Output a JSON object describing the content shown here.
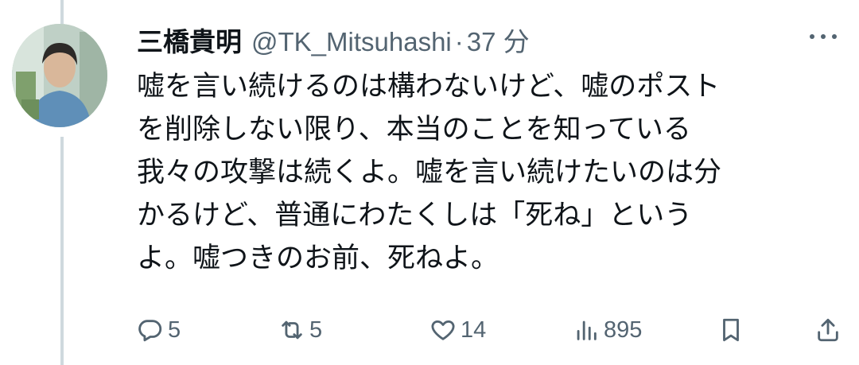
{
  "post": {
    "display_name": "三橋貴明",
    "handle": "@TK_Mitsuhashi",
    "separator": "·",
    "time": "37 分",
    "lines": [
      "嘘を言い続けるのは構わないけど、嘘のポスト",
      "を削除しない限り、本当のことを知っている",
      "我々の攻撃は続くよ。嘘を言い続けたいのは分",
      "かるけど、普通にわたくしは「死ね」という",
      "よ。嘘つきのお前、死ねよ。"
    ]
  },
  "actions": {
    "reply": {
      "icon": "reply-icon",
      "count": "5"
    },
    "repost": {
      "icon": "repost-icon",
      "count": "5"
    },
    "like": {
      "icon": "heart-icon",
      "count": "14"
    },
    "views": {
      "icon": "views-icon",
      "count": "895"
    },
    "bookmark": {
      "icon": "bookmark-icon"
    },
    "share": {
      "icon": "share-icon"
    }
  },
  "colors": {
    "text": "#0f1419",
    "secondary": "#536471",
    "thread_line": "#cfd9de"
  }
}
